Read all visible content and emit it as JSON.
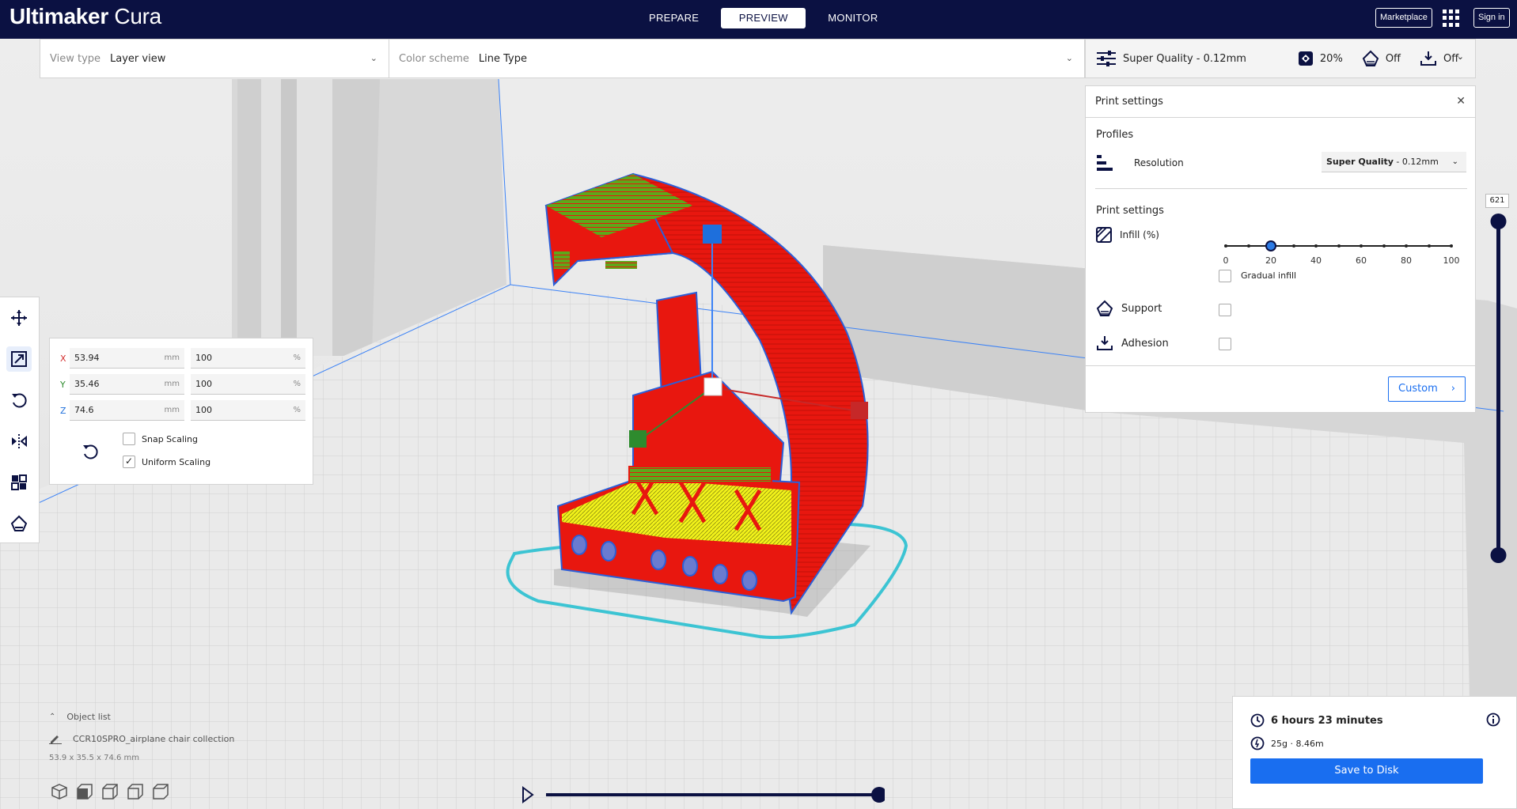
{
  "header": {
    "logo_bold": "Ultimaker",
    "logo_light": "Cura",
    "stages": [
      "PREPARE",
      "PREVIEW",
      "MONITOR"
    ],
    "active_stage": "PREVIEW",
    "marketplace_label": "Marketplace",
    "signin_label": "Sign in"
  },
  "view_panel": {
    "view_type_label": "View type",
    "view_type_value": "Layer view",
    "color_scheme_label": "Color scheme",
    "color_scheme_value": "Line Type"
  },
  "print_bar": {
    "profile": "Super Quality - 0.12mm",
    "infill": "20%",
    "support": "Off",
    "adhesion": "Off"
  },
  "print_settings": {
    "title": "Print settings",
    "profiles_heading": "Profiles",
    "resolution_label": "Resolution",
    "resolution_value_bold": "Super Quality",
    "resolution_value_rest": " - 0.12mm",
    "settings_heading": "Print settings",
    "infill_label": "Infill (%)",
    "infill_value": 20,
    "infill_ticks": [
      "0",
      "20",
      "40",
      "60",
      "80",
      "100"
    ],
    "gradual_infill_label": "Gradual infill",
    "support_label": "Support",
    "adhesion_label": "Adhesion",
    "custom_button": "Custom"
  },
  "scale_tool": {
    "x_label": "X",
    "x_mm": "53.94",
    "x_pct": "100",
    "y_label": "Y",
    "y_mm": "35.46",
    "y_pct": "100",
    "z_label": "Z",
    "z_mm": "74.6",
    "z_pct": "100",
    "unit_mm": "mm",
    "unit_pct": "%",
    "snap_scaling_label": "Snap Scaling",
    "snap_scaling_checked": false,
    "uniform_scaling_label": "Uniform Scaling",
    "uniform_scaling_checked": true
  },
  "object_list": {
    "heading": "Object list",
    "object_name": "CCR10SPRO_airplane chair collection",
    "dimensions": "53.9 x 35.5 x 74.6 mm"
  },
  "layer_slider": {
    "current_layer": "621"
  },
  "print_info": {
    "time": "6 hours 23 minutes",
    "material": "25g · 8.46m",
    "save_button": "Save to Disk"
  },
  "colors": {
    "header_bg": "#0b1142",
    "accent_blue": "#196ef0",
    "model_red": "#e8170f",
    "infill_yellow": "#f2f21a",
    "top_green": "#5ea81a",
    "skirt_cyan": "#3cc4d3"
  }
}
